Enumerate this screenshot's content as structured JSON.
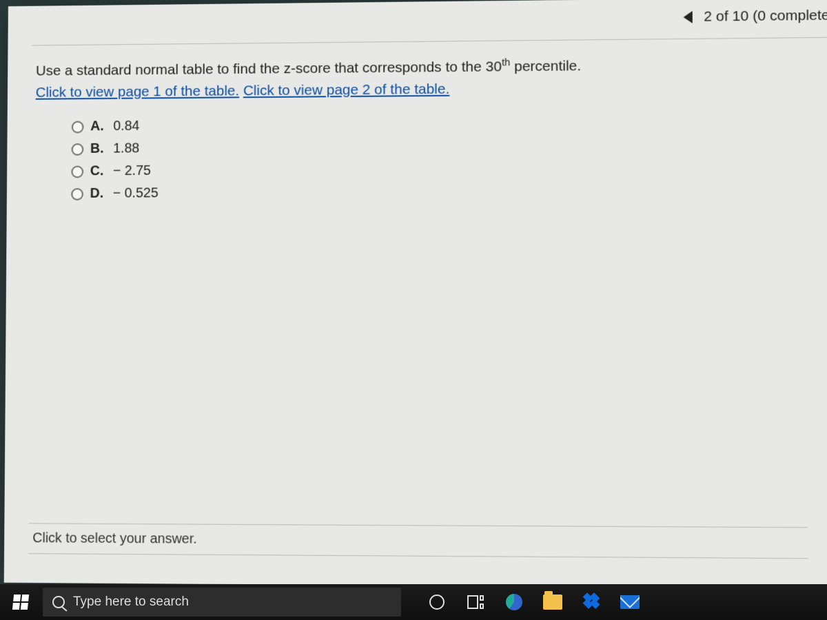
{
  "nav": {
    "progress_text": "2 of 10 (0 complete"
  },
  "question": {
    "prefix": "Use a standard normal table to find the z-score that corresponds to the 30",
    "suffix": " percentile.",
    "sup": "th",
    "link1": "Click to view page 1 of the table.",
    "link2": "Click to view page 2 of the table."
  },
  "options": [
    {
      "letter": "A.",
      "value": "0.84"
    },
    {
      "letter": "B.",
      "value": "1.88"
    },
    {
      "letter": "C.",
      "value": "− 2.75"
    },
    {
      "letter": "D.",
      "value": "− 0.525"
    }
  ],
  "footer": {
    "select_prompt": "Click to select your answer."
  },
  "taskbar": {
    "search_placeholder": "Type here to search"
  }
}
